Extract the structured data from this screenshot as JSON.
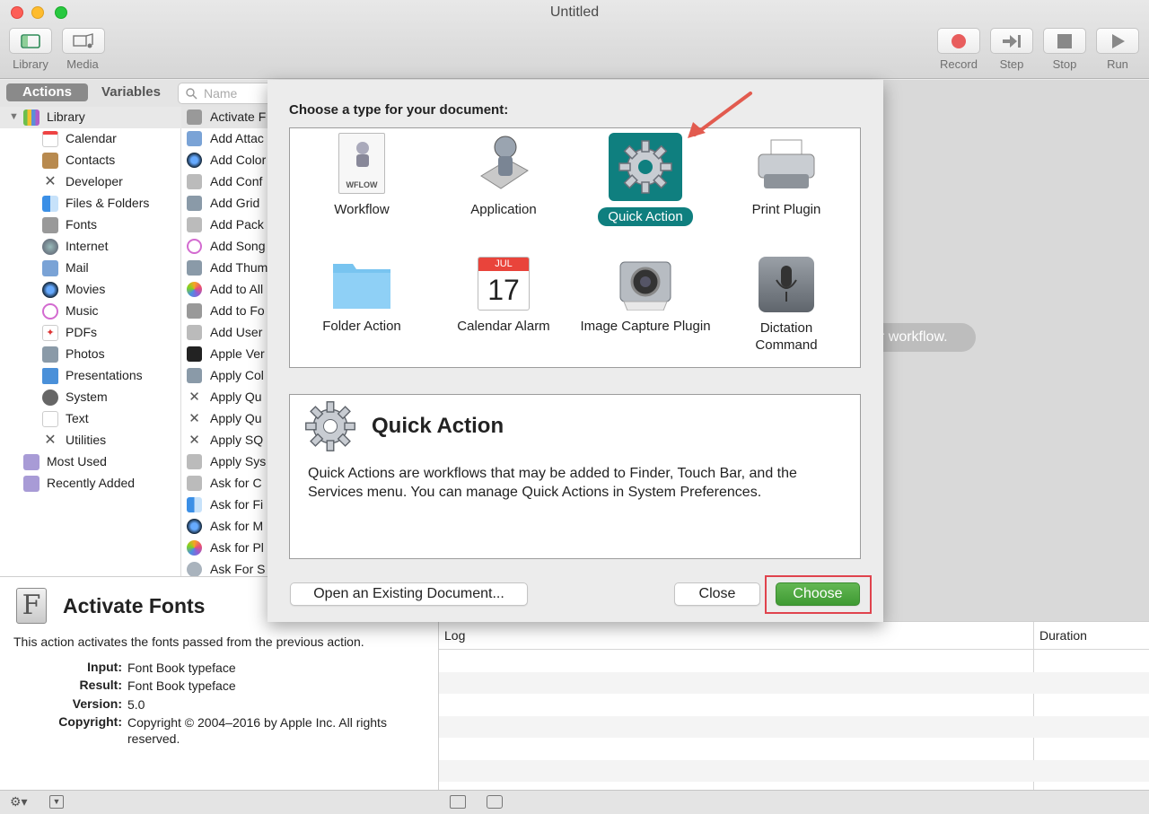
{
  "window": {
    "title": "Untitled"
  },
  "toolbar": {
    "left": [
      {
        "label": "Library",
        "icon": "sidebar-icon"
      },
      {
        "label": "Media",
        "icon": "media-icon"
      }
    ],
    "right": [
      {
        "label": "Record",
        "icon": "record-icon"
      },
      {
        "label": "Step",
        "icon": "step-icon"
      },
      {
        "label": "Stop",
        "icon": "stop-icon"
      },
      {
        "label": "Run",
        "icon": "run-icon"
      }
    ]
  },
  "library_pane": {
    "tabs": [
      "Actions",
      "Variables"
    ],
    "search_placeholder": "Name",
    "root": "Library",
    "items": [
      "Calendar",
      "Contacts",
      "Developer",
      "Files & Folders",
      "Fonts",
      "Internet",
      "Mail",
      "Movies",
      "Music",
      "PDFs",
      "Photos",
      "Presentations",
      "System",
      "Text",
      "Utilities"
    ],
    "smart_groups": [
      "Most Used",
      "Recently Added"
    ]
  },
  "actions_list": [
    "Activate F",
    "Add Attac",
    "Add Color",
    "Add Conf",
    "Add Grid",
    "Add Pack",
    "Add Song",
    "Add Thum",
    "Add to All",
    "Add to Fo",
    "Add User",
    "Apple Ver",
    "Apply Col",
    "Apply Qu",
    "Apply Qu",
    "Apply SQ",
    "Apply Sys",
    "Ask for C",
    "Ask for Fi",
    "Ask for M",
    "Ask for Pl",
    "Ask For S"
  ],
  "description": {
    "title": "Activate Fonts",
    "summary": "This action activates the fonts passed from the previous action.",
    "fields": [
      {
        "key": "Input:",
        "value": "Font Book typeface"
      },
      {
        "key": "Result:",
        "value": "Font Book typeface"
      },
      {
        "key": "Version:",
        "value": "5.0"
      },
      {
        "key": "Copyright:",
        "value": "Copyright © 2004–2016 by Apple Inc. All rights reserved."
      }
    ]
  },
  "canvas": {
    "hint": "r workflow."
  },
  "log": {
    "col_log": "Log",
    "col_duration": "Duration"
  },
  "sheet": {
    "heading": "Choose a type for your document:",
    "types": [
      {
        "label": "Workflow",
        "selected": false
      },
      {
        "label": "Application",
        "selected": false
      },
      {
        "label": "Quick Action",
        "selected": true
      },
      {
        "label": "Print Plugin",
        "selected": false
      },
      {
        "label": "Folder Action",
        "selected": false
      },
      {
        "label": "Calendar Alarm",
        "selected": false
      },
      {
        "label": "Image Capture Plugin",
        "selected": false
      },
      {
        "label": "Dictation Command",
        "selected": false
      }
    ],
    "workflow_badge": "WFLOW",
    "calendar_month": "JUL",
    "calendar_day": "17",
    "info_title": "Quick Action",
    "info_text": "Quick Actions are workflows that may be added to Finder, Touch Bar, and the Services menu. You can manage Quick Actions in System Preferences.",
    "open_button": "Open an Existing Document...",
    "close_button": "Close",
    "choose_button": "Choose"
  },
  "colors": {
    "selection_teal": "#0f7f7f",
    "choose_green": "#4ca93f",
    "annotation_red": "#e0434d"
  }
}
